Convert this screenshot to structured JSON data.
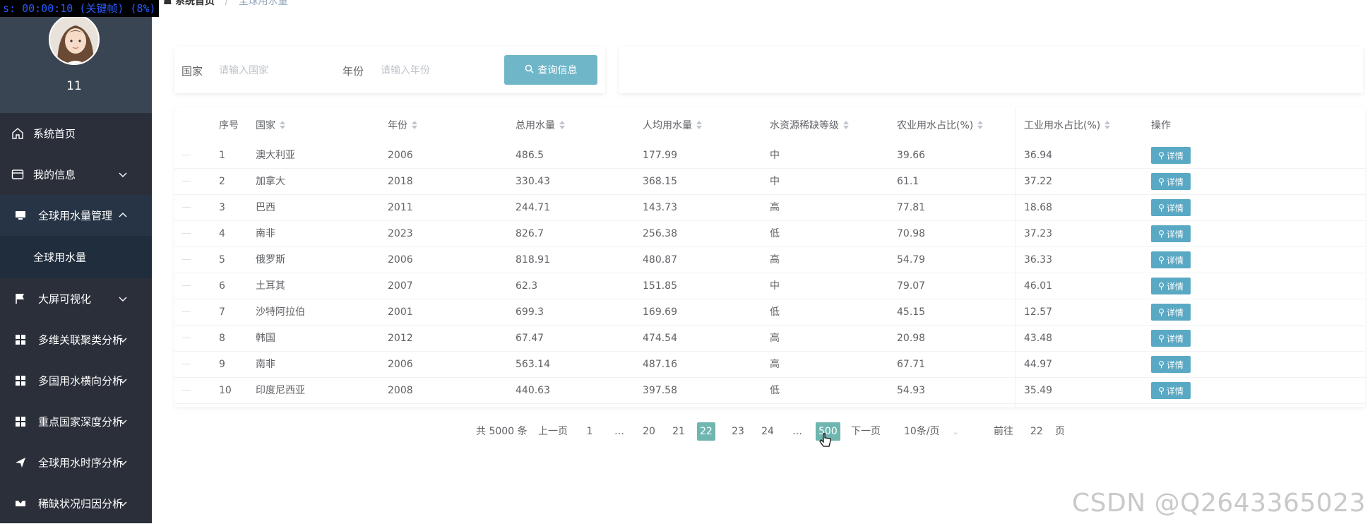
{
  "recording_overlay": "s: 00:00:10 (关键帧) (8%)",
  "user": {
    "name": "11"
  },
  "sidebar": {
    "items": [
      {
        "label": "系统首页",
        "icon": "home-icon"
      },
      {
        "label": "我的信息",
        "icon": "id-card-icon",
        "expandable": true
      },
      {
        "label": "全球用水量管理",
        "icon": "monitor-icon",
        "expanded": true
      },
      {
        "label": "全球用水量",
        "submenu": true
      },
      {
        "label": "大屏可视化",
        "icon": "flag-icon",
        "expandable": true
      },
      {
        "label": "多维关联聚类分析",
        "icon": "grid-icon",
        "expandable": true
      },
      {
        "label": "多国用水横向分析",
        "icon": "grid-icon",
        "expandable": true
      },
      {
        "label": "重点国家深度分析",
        "icon": "grid-icon",
        "expandable": true
      },
      {
        "label": "全球用水时序分析",
        "icon": "send-icon",
        "expandable": true
      },
      {
        "label": "稀缺状况归因分析",
        "icon": "scissors-icon",
        "expandable": true
      }
    ]
  },
  "breadcrumb": {
    "home": "系统首页",
    "separator": "/",
    "current": "全球用水量"
  },
  "search": {
    "country_label": "国家",
    "country_placeholder": "请输入国家",
    "country_value": "",
    "year_label": "年份",
    "year_placeholder": "请输入年份",
    "year_value": "",
    "button_label": "查询信息"
  },
  "table": {
    "headers": [
      "序号",
      "国家",
      "年份",
      "总用水量",
      "人均用水量",
      "水资源稀缺等级",
      "农业用水占比(%)",
      "工业用水占比(%)",
      "操作"
    ],
    "detail_label": "详情",
    "rows": [
      [
        "1",
        "澳大利亚",
        "2006",
        "486.5",
        "177.99",
        "中",
        "39.66",
        "36.94"
      ],
      [
        "2",
        "加拿大",
        "2018",
        "330.43",
        "368.15",
        "中",
        "61.1",
        "37.22"
      ],
      [
        "3",
        "巴西",
        "2011",
        "244.71",
        "143.73",
        "高",
        "77.81",
        "18.68"
      ],
      [
        "4",
        "南非",
        "2023",
        "826.7",
        "256.38",
        "低",
        "70.98",
        "37.23"
      ],
      [
        "5",
        "俄罗斯",
        "2006",
        "818.91",
        "480.87",
        "高",
        "54.79",
        "36.33"
      ],
      [
        "6",
        "土耳其",
        "2007",
        "62.3",
        "151.85",
        "中",
        "79.07",
        "46.01"
      ],
      [
        "7",
        "沙特阿拉伯",
        "2001",
        "699.3",
        "169.69",
        "低",
        "45.15",
        "12.57"
      ],
      [
        "8",
        "韩国",
        "2012",
        "67.47",
        "474.54",
        "高",
        "20.98",
        "43.48"
      ],
      [
        "9",
        "南非",
        "2006",
        "563.14",
        "487.16",
        "高",
        "67.71",
        "44.97"
      ],
      [
        "10",
        "印度尼西亚",
        "2008",
        "440.63",
        "397.58",
        "低",
        "54.93",
        "35.49"
      ]
    ]
  },
  "pagination": {
    "total": "共 5000 条",
    "prev": "上一页",
    "next": "下一页",
    "pages": [
      "1",
      "…",
      "20",
      "21",
      "22",
      "23",
      "24",
      "…",
      "500"
    ],
    "current": "22",
    "page_size": "10条/页",
    "goto_label": "前往",
    "goto_value": "22",
    "goto_suffix": "页"
  },
  "watermark": "CSDN @Q2643365023",
  "colors": {
    "sidebar_bg": "#2b2f3a",
    "profile_bg": "#3a4553",
    "accent": "#6fb6c9",
    "active_page": "#6fb6b0"
  }
}
